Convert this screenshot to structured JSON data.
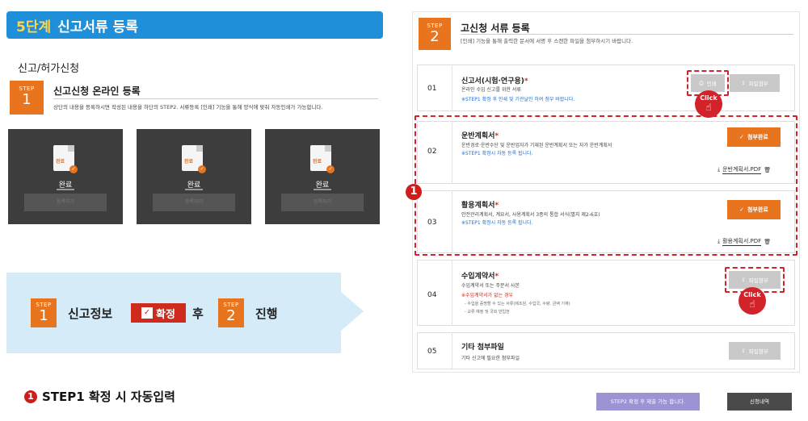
{
  "banner": {
    "step": "5단계",
    "title": "신고서류 등록"
  },
  "section_label": "신고/허가신청",
  "left_step": {
    "step_word": "STEP",
    "step_num": "1",
    "title": "신고신청 온라인 등록",
    "desc": "상단의 내용을 등록하시면 작성된 내용을 하단의 STEP2. 서류등록 [인쇄] 기능을 통해 양식에 맞춰 자동인쇄가 가능합니다."
  },
  "cards": [
    {
      "doc_tag": "완료",
      "label": "완료",
      "bar": "등록하기"
    },
    {
      "doc_tag": "완료",
      "label": "완료",
      "bar": "등록하기"
    },
    {
      "doc_tag": "완료",
      "label": "완료",
      "bar": "등록하기"
    }
  ],
  "flow": {
    "step1_word": "STEP",
    "step1_num": "1",
    "text1": "신고정보",
    "confirm": "확정",
    "text2": "후",
    "step2_word": "STEP",
    "step2_num": "2",
    "text3": "진행"
  },
  "footnote": {
    "marker": "1",
    "text": "STEP1 확정 시 자동입력"
  },
  "right_step": {
    "step_word": "STEP",
    "step_num": "2",
    "title": "고신청 서류 등록",
    "desc": "[인쇄] 기능을 통해 출력한 문서에 서명 후 스캔한 파일을 첨부하시기 바랍니다."
  },
  "rows": [
    {
      "num": "01",
      "title": "신고서(시험·연구용)",
      "req": "*",
      "desc": "온라인 수입 신고를 위한 서류",
      "note": "※STEP1 확정 후 인쇄 및 기관날인 하여 첨부 바랍니다.",
      "print_label": "인쇄",
      "attach_label": "파일첨부"
    },
    {
      "num": "02",
      "title": "운반계획서",
      "req": "*",
      "desc": "운반경로·운반수단 및 운반업자가 기재된 운반계획서 또는 자가 운반계획서",
      "note": "※STEP1 확정시 자동 등록 됩니다.",
      "done_label": "첨부완료",
      "file": "운반계획서.PDF"
    },
    {
      "num": "03",
      "title": "활용계획서",
      "req": "*",
      "desc": "안전관리계획서, 계요서, 사용계획서 3종의 통합 서식(별지 제2-6호)",
      "note": "※STEP1 확정시 자동 등록 됩니다.",
      "done_label": "첨부완료",
      "file": "활용계획서.PDF"
    },
    {
      "num": "04",
      "title": "수입계약서",
      "req": "*",
      "desc": "수입계약서 또는 주문서 사본",
      "note": "※수입계약서가 없는 경우",
      "sub1": "- 수입을 증명할 수 있는 서류(제조원, 수입국, 수량, 금액 기재)",
      "sub2": "- 교류 예정 및 국외 반입한",
      "attach_label": "파일첨부"
    },
    {
      "num": "05",
      "title": "기타 첨부파일",
      "req": "",
      "desc": "기타 신고에 필요한 첨부파일",
      "attach_label": "파일첨부"
    }
  ],
  "callout_marker": "1",
  "click_label": "Click",
  "bottom": {
    "submit": "STEP2 확정 후 제출 가능 합니다.",
    "history": "신청내역"
  }
}
